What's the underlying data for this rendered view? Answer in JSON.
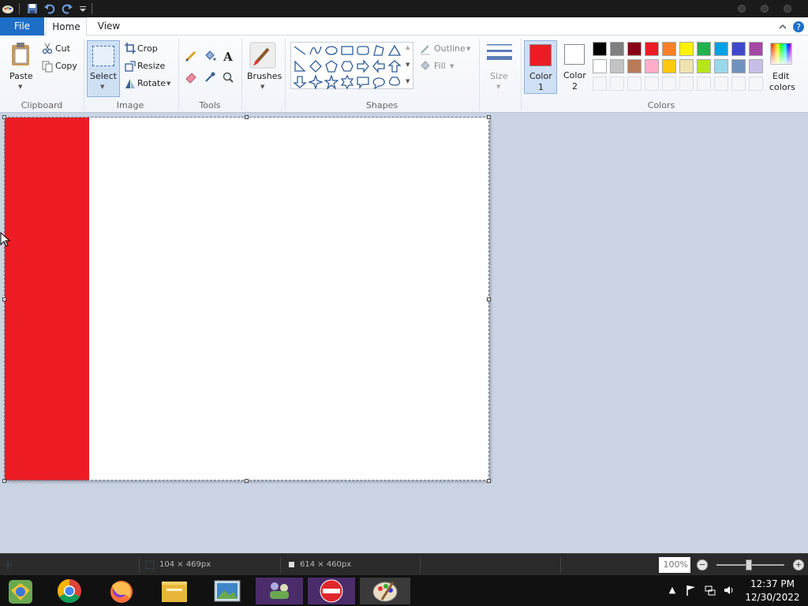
{
  "tabs": {
    "file": "File",
    "home": "Home",
    "view": "View"
  },
  "ribbon": {
    "clipboard": {
      "paste": "Paste",
      "cut": "Cut",
      "copy": "Copy",
      "label": "Clipboard"
    },
    "image": {
      "select": "Select",
      "crop": "Crop",
      "resize": "Resize",
      "rotate": "Rotate",
      "label": "Image"
    },
    "tools": {
      "label": "Tools"
    },
    "brushes": {
      "label": "Brushes"
    },
    "shapes": {
      "outline": "Outline",
      "fill": "Fill",
      "label": "Shapes"
    },
    "size": {
      "label": "Size"
    },
    "colors": {
      "color1": "Color",
      "color1_num": "1",
      "color2": "Color",
      "color2_num": "2",
      "edit": "Edit",
      "edit2": "colors",
      "label": "Colors",
      "color1_value": "#ed1c24",
      "color2_value": "#ffffff",
      "palette_row1": [
        "#000000",
        "#7f7f7f",
        "#880015",
        "#ed1c24",
        "#ff7f27",
        "#fff200",
        "#22b14c",
        "#00a2e8",
        "#3f48cc",
        "#a349a4"
      ],
      "palette_row2": [
        "#ffffff",
        "#c3c3c3",
        "#b97a57",
        "#ffaec9",
        "#ffc90e",
        "#efe4b0",
        "#b5e61d",
        "#99d9ea",
        "#7092be",
        "#c8bfe7"
      ]
    }
  },
  "status": {
    "selection_size": "104 × 469px",
    "image_size": "614 × 460px",
    "zoom": "100%"
  },
  "clock": {
    "time": "12:37 PM",
    "date": "12/30/2022"
  }
}
